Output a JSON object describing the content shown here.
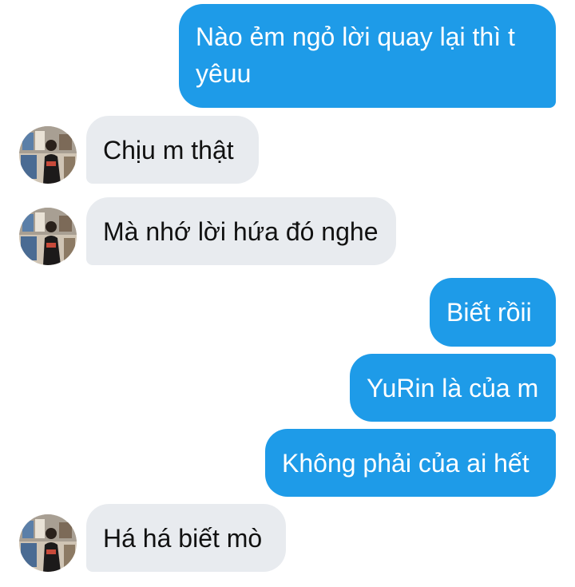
{
  "conversation": {
    "messages": [
      {
        "id": "m1",
        "direction": "sent",
        "lines": [
          "Nào ẻm ngỏ lời quay lại thì t",
          "yêuu"
        ]
      },
      {
        "id": "m2",
        "direction": "received",
        "text": "Chịu m thật"
      },
      {
        "id": "m3",
        "direction": "received",
        "text": "Mà nhớ lời hứa đó nghe"
      },
      {
        "id": "m4",
        "direction": "sent",
        "text": "Biết rồii"
      },
      {
        "id": "m5",
        "direction": "sent",
        "text": "YuRin là của m"
      },
      {
        "id": "m6",
        "direction": "sent",
        "text": "Không phải của ai hết"
      },
      {
        "id": "m7",
        "direction": "received",
        "text": "Há há biết mò"
      }
    ]
  },
  "colors": {
    "sent_bubble": "#1e9be8",
    "received_bubble": "#e8ebef",
    "sent_text": "#ffffff",
    "received_text": "#111111"
  }
}
